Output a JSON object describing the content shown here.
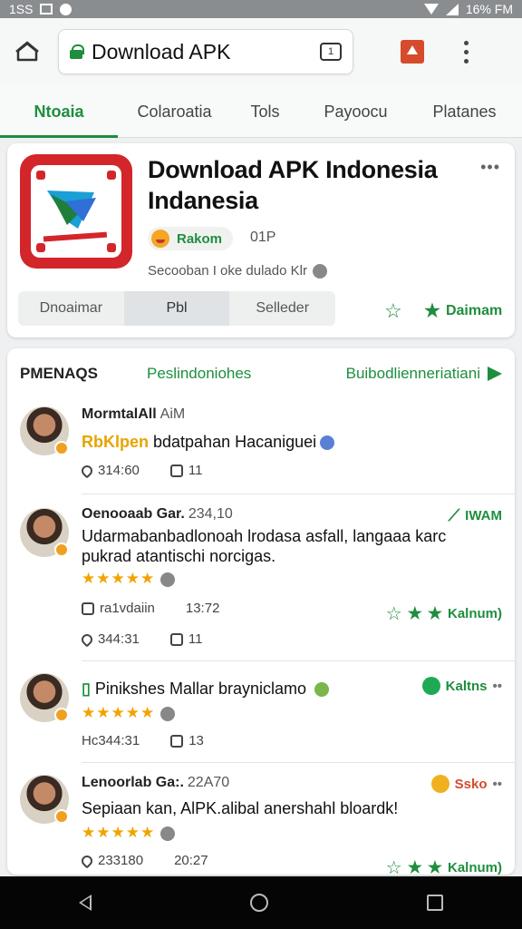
{
  "status": {
    "time": "1SS",
    "battery": "16% FM"
  },
  "browser": {
    "url": "Download APK",
    "tab_count": "1"
  },
  "tabs": [
    {
      "label": "Ntoaia",
      "active": true
    },
    {
      "label": "Colaroatia",
      "active": false
    },
    {
      "label": "Tols",
      "active": false
    },
    {
      "label": "Payoocu",
      "active": false
    },
    {
      "label": "Platanes",
      "active": false
    }
  ],
  "app": {
    "title": "Download APK Indonesia Indanesia",
    "rating_label": "Rakom",
    "rating_aux": "01P",
    "subtitle": "Secooban I oke dulado Klr",
    "segments": [
      "Dnoaimar",
      "Pbl",
      "Selleder"
    ],
    "cta": "Daimam",
    "more": "•••"
  },
  "reviews": {
    "header": {
      "left": "PMENAQS",
      "middle": "Peslindoniohes",
      "right": "Buibodlienneriatiani"
    },
    "items": [
      {
        "name": "MormtalAll",
        "time": "AiM",
        "highlight": "RbKlpen",
        "text": " bdatpahan Hacaniguei",
        "stars": "",
        "meta1": "314:60",
        "meta2": "11",
        "right": "",
        "meta_extra_left": "",
        "meta_extra_right": ""
      },
      {
        "name": "Oenooaab Gar.",
        "time": "234,10",
        "highlight": "",
        "text": "Udarmabanbadlonoah lrodasa asfall, langaaa karc pukrad atantischi norcigas.",
        "stars": "★★★★★",
        "meta1": "344:31",
        "meta2": "11",
        "right": "IWAM",
        "meta_extra_left": "ra1vdaiin",
        "meta_extra_right": "13:72",
        "action": "Kalnum)"
      },
      {
        "name": "",
        "time": "",
        "highlight": "",
        "text": "Pinikshes Mallar brayniclamo",
        "stars": "★★★★★",
        "meta1": "Hc344:31",
        "meta2": "13",
        "right": "Kaltns",
        "meta_extra_left": "",
        "meta_extra_right": ""
      },
      {
        "name": "Lenoorlab Ga:.",
        "time": "22A70",
        "highlight": "",
        "text": "Sepiaan kan, AlPK.alibal anershahl bloardk!",
        "stars": "★★★★★",
        "meta1": "233180",
        "meta2": "20:27",
        "right": "Ssko",
        "action": "Kalnum)"
      }
    ]
  },
  "colors": {
    "accent": "#1e8e3e",
    "brand_red": "#d3262b",
    "star": "#f2a300"
  },
  "icons": [
    "home-icon",
    "lock-icon",
    "tabs-icon",
    "bookmark-icon",
    "menu-icon",
    "star-icon",
    "send-icon",
    "back-icon",
    "circle-home-icon",
    "recents-icon"
  ]
}
